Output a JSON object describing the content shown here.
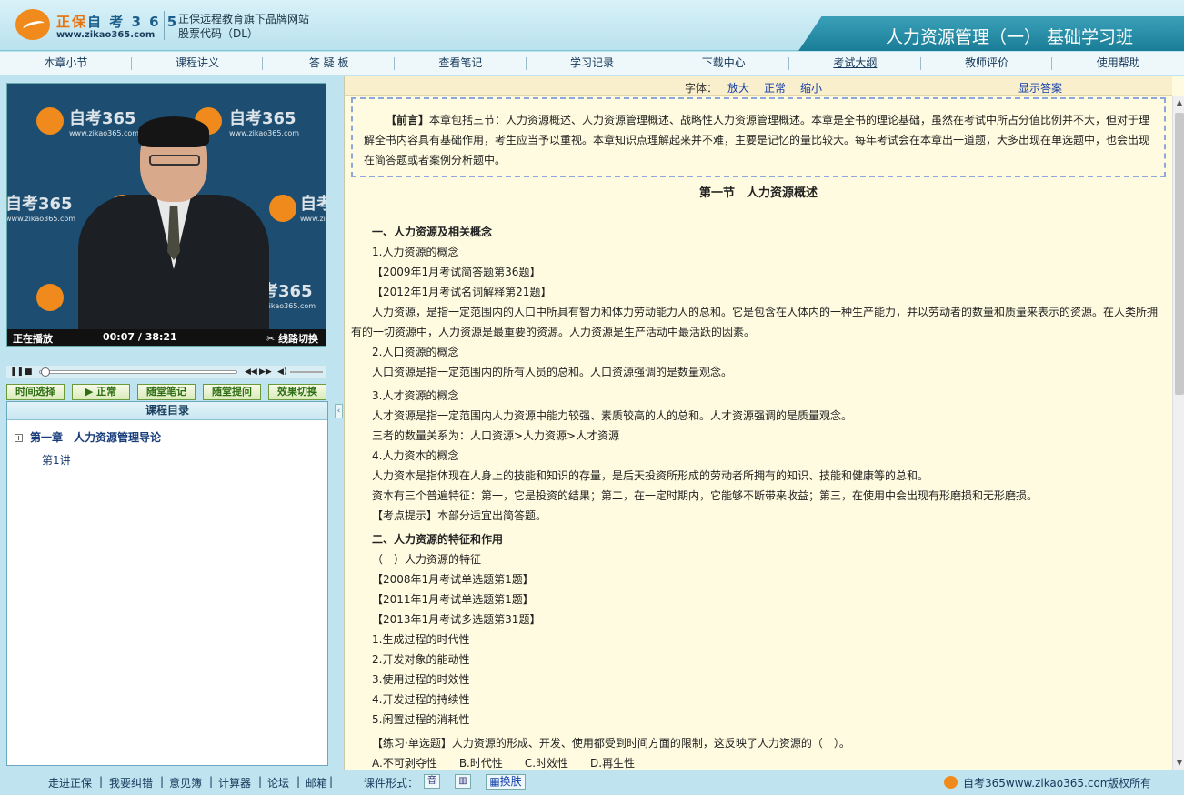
{
  "header": {
    "brand_main": "正保",
    "brand_sub": "自 考 3 6 5",
    "brand_url": "www.zikao365.com",
    "tagline": "正保远程教育旗下品牌网站",
    "stock": "股票代码（DL）",
    "course_title": "人力资源管理（一） 基础学习班"
  },
  "nav": [
    {
      "label": "本章小节",
      "active": false
    },
    {
      "label": "课程讲义",
      "active": false
    },
    {
      "label": "答 疑 板",
      "active": false
    },
    {
      "label": "查看笔记",
      "active": false
    },
    {
      "label": "学习记录",
      "active": false
    },
    {
      "label": "下载中心",
      "active": false
    },
    {
      "label": "考试大纲",
      "active": true
    },
    {
      "label": "教师评价",
      "active": false
    },
    {
      "label": "使用帮助",
      "active": false
    }
  ],
  "video": {
    "watermark": "自考365",
    "watermark_url": "www.zikao365.com",
    "status_left": "正在播放",
    "time": "00:07 / 38:21",
    "status_right": "线路切换",
    "progress": 0.003
  },
  "video_buttons": [
    "时间选择",
    "▶ 正常",
    "随堂笔记",
    "随堂提问",
    "效果切换"
  ],
  "toc": {
    "title": "课程目录",
    "chapter": "第一章　人力资源管理导论",
    "expand_symbol": "+",
    "lesson": "第1讲"
  },
  "toolbar": {
    "font_label": "字体：",
    "enlarge": "放大",
    "normal": "正常",
    "shrink": "缩小",
    "show_answer": "显示答案"
  },
  "content": {
    "preface_label": "【前言】",
    "preface": "本章包括三节：人力资源概述、人力资源管理概述、战略性人力资源管理概述。本章是全书的理论基础，虽然在考试中所占分值比例并不大，但对于理解全书内容具有基础作用，考生应当予以重视。本章知识点理解起来并不难，主要是记忆的量比较大。每年考试会在本章出一道题，大多出现在单选题中，也会出现在简答题或者案例分析题中。",
    "section_title": "第一节　人力资源概述",
    "lines": [
      "一、人力资源及相关概念",
      "1.人力资源的概念",
      "【2009年1月考试简答题第36题】",
      "【2012年1月考试名词解释第21题】",
      "人力资源，是指一定范围内的人口中所具有智力和体力劳动能力人的总和。它是包含在人体内的一种生产能力，并以劳动者的数量和质量来表示的资源。在人类所拥有的一切资源中，人力资源是最重要的资源。人力资源是生产活动中最活跃的因素。",
      "2.人口资源的概念",
      "人口资源是指一定范围内的所有人员的总和。人口资源强调的是数量观念。",
      "3.人才资源的概念",
      "人才资源是指一定范围内人力资源中能力较强、素质较高的人的总和。人才资源强调的是质量观念。",
      "三者的数量关系为：人口资源>人力资源>人才资源",
      "4.人力资本的概念",
      "人力资本是指体现在人身上的技能和知识的存量，是后天投资所形成的劳动者所拥有的知识、技能和健康等的总和。",
      "资本有三个普遍特征：第一，它是投资的结果；第二，在一定时期内，它能够不断带来收益；第三，在使用中会出现有形磨损和无形磨损。",
      "【考点提示】本部分适宜出简答题。",
      "二、人力资源的特征和作用",
      "（一）人力资源的特征",
      "【2008年1月考试单选题第1题】",
      "【2011年1月考试单选题第1题】",
      "【2013年1月考试多选题第31题】",
      "1.生成过程的时代性",
      "2.开发对象的能动性",
      "3.使用过程的时效性",
      "4.开发过程的持续性",
      "5.闲置过程的消耗性",
      "【练习·单选题】人力资源的形成、开发、使用都受到时间方面的限制，这反映了人力资源的（　）。",
      "A.不可剥夺性　　B.时代性　　C.时效性　　D.再生性"
    ]
  },
  "footer": {
    "links": [
      "走进正保",
      "我要纠错",
      "意见簿",
      "计算器",
      "论坛",
      "邮箱"
    ],
    "format_label": "课件形式：",
    "icon_audio": "音",
    "icon_layout": "▥",
    "skin": "换肤",
    "site": "自考365www.zikao365.com",
    "copyright": "版权所有"
  }
}
